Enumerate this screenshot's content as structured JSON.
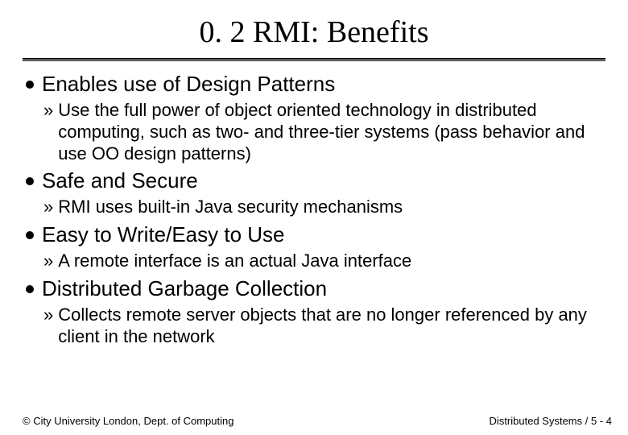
{
  "title": "0. 2 RMI: Benefits",
  "items": [
    {
      "heading": "Enables use of Design Patterns",
      "sub": "Use the full power of object oriented technology in distributed computing, such as two- and three-tier systems (pass behavior and use OO design patterns)"
    },
    {
      "heading": "Safe and Secure",
      "sub": "RMI uses built-in Java security mechanisms"
    },
    {
      "heading": "Easy to Write/Easy to Use",
      "sub": "A remote interface is an actual Java interface"
    },
    {
      "heading": "Distributed Garbage Collection",
      "sub": "Collects remote server objects that are no longer referenced by any client in the network"
    }
  ],
  "footer": {
    "left": "© City University London, Dept. of Computing",
    "right": "Distributed Systems / 5 - 4"
  },
  "marker": "»"
}
